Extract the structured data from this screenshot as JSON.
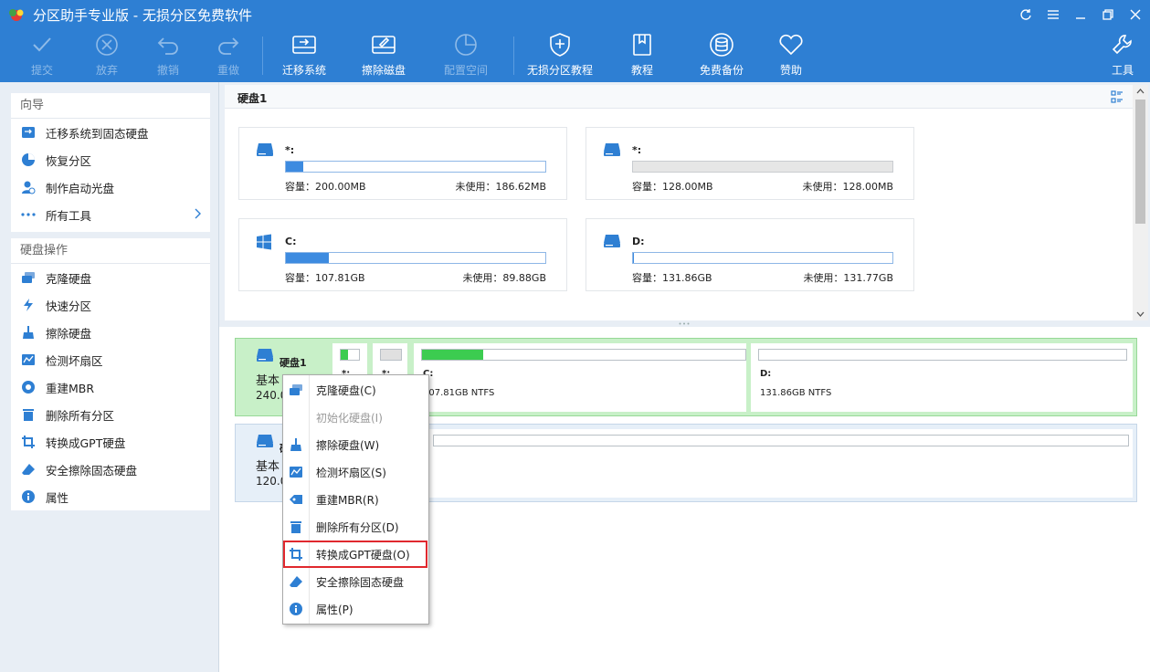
{
  "window": {
    "title": "分区助手专业版 - 无损分区免费软件"
  },
  "toolbar": {
    "commit": "提交",
    "discard": "放弃",
    "undo": "撤销",
    "redo": "重做",
    "migrate": "迁移系统",
    "wipe": "擦除磁盘",
    "config_space": "配置空间",
    "tutorial_lossless": "无损分区教程",
    "tutorial": "教程",
    "backup": "免费备份",
    "donate": "赞助",
    "tools": "工具"
  },
  "sidebar": {
    "guide_title": "向导",
    "guide_items": [
      "迁移系统到固态硬盘",
      "恢复分区",
      "制作启动光盘",
      "所有工具"
    ],
    "disk_ops_title": "硬盘操作",
    "disk_ops_items": [
      "克隆硬盘",
      "快速分区",
      "擦除硬盘",
      "检测坏扇区",
      "重建MBR",
      "删除所有分区",
      "转换成GPT硬盘",
      "安全擦除固态硬盘",
      "属性"
    ]
  },
  "top": {
    "disk_name": "硬盘1",
    "cards": [
      {
        "name": "*:",
        "capacity": "容量：200.00MB",
        "free": "未使用：186.62MB",
        "used_fraction": 0.066,
        "icon": "drive-icon"
      },
      {
        "name": "*:",
        "capacity": "容量：128.00MB",
        "free": "未使用：128.00MB",
        "used_fraction": 0,
        "icon": "drive-icon"
      },
      {
        "name": "C:",
        "capacity": "容量：107.81GB",
        "free": "未使用：89.88GB",
        "used_fraction": 0.166,
        "icon": "windows-icon"
      },
      {
        "name": "D:",
        "capacity": "容量：131.86GB",
        "free": "未使用：131.77GB",
        "used_fraction": 0.001,
        "icon": "drive-icon"
      }
    ]
  },
  "bottom": {
    "disk1": {
      "label": "硬盘1",
      "type": "基本",
      "size": "240.0",
      "partitions": [
        {
          "name": "*:",
          "info": "",
          "used_fraction": 0.4
        },
        {
          "name": "*:",
          "info": "",
          "used_fraction": 0
        },
        {
          "name": "C:",
          "info": "107.81GB NTFS",
          "used_fraction": 0.19
        },
        {
          "name": "D:",
          "info": "131.86GB NTFS",
          "used_fraction": 0
        }
      ]
    },
    "disk2": {
      "label": "硬",
      "type": "基本",
      "size": "120.0"
    }
  },
  "context_menu": {
    "items": [
      {
        "label": "克隆硬盘(C)",
        "icon": "clone-disk-icon",
        "enabled": true
      },
      {
        "label": "初始化硬盘(I)",
        "icon": "",
        "enabled": false
      },
      {
        "label": "擦除硬盘(W)",
        "icon": "wipe-icon",
        "enabled": true
      },
      {
        "label": "检测坏扇区(S)",
        "icon": "sector-check-icon",
        "enabled": true
      },
      {
        "label": "重建MBR(R)",
        "icon": "tag-icon",
        "enabled": true
      },
      {
        "label": "删除所有分区(D)",
        "icon": "trash-icon",
        "enabled": true
      },
      {
        "label": "转换成GPT硬盘(O)",
        "icon": "convert-icon",
        "enabled": true
      },
      {
        "label": "安全擦除固态硬盘",
        "icon": "eraser-icon",
        "enabled": true
      },
      {
        "label": "属性(P)",
        "icon": "info-icon",
        "enabled": true
      }
    ],
    "highlighted_index": 6
  },
  "colors": {
    "accent": "#2e7fd3",
    "highlight": "#e0282e",
    "used_bar": "#3d8be0",
    "partition_bar": "#3ccc50"
  }
}
